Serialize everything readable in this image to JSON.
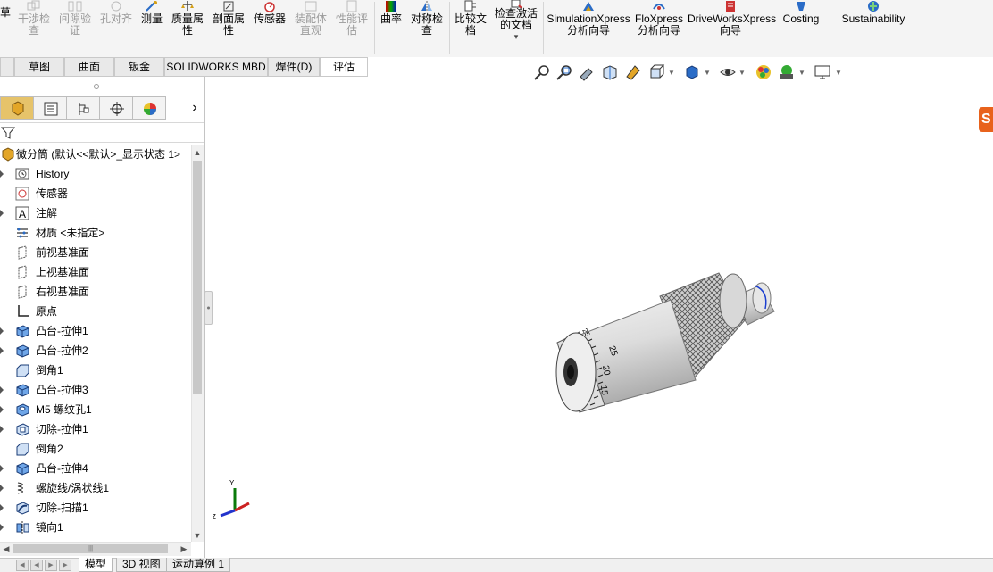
{
  "ribbon": {
    "buttons": [
      {
        "id": "draft-partial",
        "label": "草",
        "disabled": false
      },
      {
        "id": "interference-check",
        "label": "干涉检查",
        "disabled": true
      },
      {
        "id": "clearance-verify",
        "label": "间隙验证",
        "disabled": true
      },
      {
        "id": "hole-alignment",
        "label": "孔对齐",
        "disabled": true
      },
      {
        "id": "measure",
        "label": "测量",
        "disabled": false
      },
      {
        "id": "mass-properties",
        "label": "质量属性",
        "disabled": false
      },
      {
        "id": "section-properties",
        "label": "剖面属性",
        "disabled": false
      },
      {
        "id": "sensor",
        "label": "传感器",
        "disabled": false
      },
      {
        "id": "assembly-visualization",
        "label": "装配体直观",
        "disabled": true
      },
      {
        "id": "performance-evaluation",
        "label": "性能评估",
        "disabled": true
      },
      {
        "id": "curvature",
        "label": "曲率",
        "disabled": false
      },
      {
        "id": "symmetry-check",
        "label": "对称检查",
        "disabled": false
      },
      {
        "id": "compare-documents",
        "label": "比较文档",
        "disabled": false
      },
      {
        "id": "check-active-document",
        "label": "检查激活的文档",
        "disabled": false
      },
      {
        "id": "simulationxpress",
        "label": "SimulationXpress 分析向导",
        "disabled": false
      },
      {
        "id": "floxpress",
        "label": "FloXpress 分析向导",
        "disabled": false
      },
      {
        "id": "driveworksxpress",
        "label": "DriveWorksXpress 向导",
        "disabled": false
      },
      {
        "id": "costing",
        "label": "Costing",
        "disabled": false
      },
      {
        "id": "sustainability",
        "label": "Sustainability",
        "disabled": false
      }
    ],
    "check_doc_dropdown": "▾"
  },
  "tabs": [
    "草图",
    "曲面",
    "钣金",
    "SOLIDWORKS MBD",
    "焊件(D)",
    "评估"
  ],
  "active_tab": "评估",
  "panel_tabs_more": "›",
  "tree": {
    "root": "微分筒 (默认<<默认>_显示状态 1>",
    "nodes": [
      {
        "label": "History",
        "icon": "history-icon",
        "expandable": true
      },
      {
        "label": "传感器",
        "icon": "sensor-icon",
        "expandable": false
      },
      {
        "label": "注解",
        "icon": "annotation-icon",
        "expandable": true
      },
      {
        "label": "材质 <未指定>",
        "icon": "material-icon",
        "expandable": false
      },
      {
        "label": "前视基准面",
        "icon": "plane-icon",
        "expandable": false
      },
      {
        "label": "上视基准面",
        "icon": "plane-icon",
        "expandable": false
      },
      {
        "label": "右视基准面",
        "icon": "plane-icon",
        "expandable": false
      },
      {
        "label": "原点",
        "icon": "origin-icon",
        "expandable": false
      },
      {
        "label": "凸台-拉伸1",
        "icon": "extrude-boss-icon",
        "expandable": true
      },
      {
        "label": "凸台-拉伸2",
        "icon": "extrude-boss-icon",
        "expandable": true
      },
      {
        "label": "倒角1",
        "icon": "chamfer-icon",
        "expandable": false
      },
      {
        "label": "凸台-拉伸3",
        "icon": "extrude-boss-icon",
        "expandable": true
      },
      {
        "label": "M5 螺纹孔1",
        "icon": "hole-wizard-icon",
        "expandable": true
      },
      {
        "label": "切除-拉伸1",
        "icon": "extrude-cut-icon",
        "expandable": true
      },
      {
        "label": "倒角2",
        "icon": "chamfer-icon",
        "expandable": false
      },
      {
        "label": "凸台-拉伸4",
        "icon": "extrude-boss-icon",
        "expandable": true
      },
      {
        "label": "螺旋线/涡状线1",
        "icon": "helix-icon",
        "expandable": true
      },
      {
        "label": "切除-扫描1",
        "icon": "sweep-cut-icon",
        "expandable": true
      },
      {
        "label": "镜向1",
        "icon": "mirror-icon",
        "expandable": true
      }
    ]
  },
  "hscroll_grip": "|||",
  "bottom_tabs": [
    "模型",
    "3D 视图",
    "运动算例 1"
  ],
  "active_bottom_tab": "模型",
  "viewport": {
    "dial_numbers": [
      "25",
      "20",
      "15",
      "25"
    ],
    "triad_axes": [
      "Y",
      "Z"
    ],
    "logo": "S"
  },
  "colors": {
    "accent_orange": "#e8621c",
    "active_tab_bg": "#ffffff",
    "ribbon_bg": "#f4f4f4"
  }
}
